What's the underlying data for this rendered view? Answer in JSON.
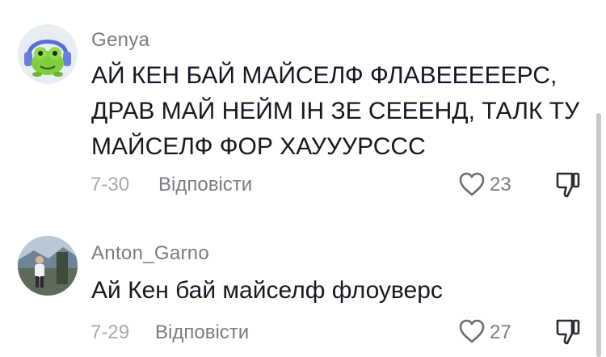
{
  "comments": [
    {
      "username": "Genya",
      "text": "АЙ КЕН БАЙ МАЙСЕЛФ ФЛАВЕЕЕЕЕРС, ДРАВ МАЙ НЕЙМ ІН ЗЕ СЕЕЕНД, ТАЛК ТУ МАЙСЕЛФ ФОР ХАУУУРССС",
      "date": "7-30",
      "reply_label": "Відповісти",
      "likes": "23",
      "avatar_icon": "cartoon-frog-headphones-avatar"
    },
    {
      "username": "Anton_Garno",
      "text": "Ай Кен бай майселф флоуверс",
      "date": "7-29",
      "reply_label": "Відповісти",
      "likes": "27",
      "avatar_icon": "person-photo-avatar"
    }
  ],
  "icons": {
    "like": "heart-outline-icon",
    "dislike": "thumbs-down-icon"
  },
  "colors": {
    "text": "#161823",
    "muted": "#7a7c83",
    "date": "#a7a8ad"
  }
}
